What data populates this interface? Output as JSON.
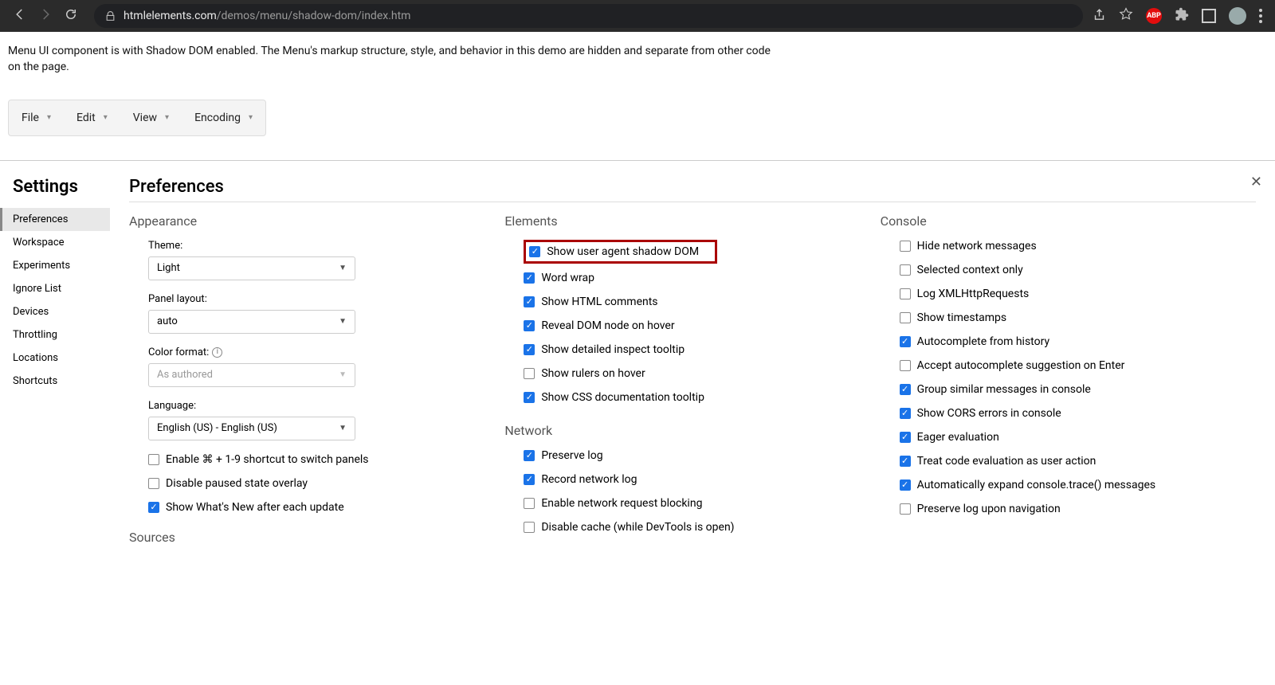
{
  "browser": {
    "url_host": "htmlelements.com",
    "url_rest": "/demos/menu/shadow-dom/index.htm",
    "abp_label": "ABP"
  },
  "page": {
    "description": "Menu UI component is with Shadow DOM enabled. The Menu's markup structure, style, and behavior in this demo are hidden and separate from other code on the page.",
    "menu": [
      "File",
      "Edit",
      "View",
      "Encoding"
    ]
  },
  "devtools": {
    "title": "Settings",
    "panel_title": "Preferences",
    "nav": [
      "Preferences",
      "Workspace",
      "Experiments",
      "Ignore List",
      "Devices",
      "Throttling",
      "Locations",
      "Shortcuts"
    ],
    "appearance": {
      "heading": "Appearance",
      "theme_label": "Theme:",
      "theme_value": "Light",
      "panel_layout_label": "Panel layout:",
      "panel_layout_value": "auto",
      "color_format_label": "Color format:",
      "color_format_value": "As authored",
      "language_label": "Language:",
      "language_value": "English (US) - English (US)",
      "checks": [
        {
          "label": "Enable ⌘ + 1-9 shortcut to switch panels",
          "on": false
        },
        {
          "label": "Disable paused state overlay",
          "on": false
        },
        {
          "label": "Show What's New after each update",
          "on": true
        }
      ],
      "sources_heading": "Sources"
    },
    "elements": {
      "heading": "Elements",
      "checks": [
        {
          "label": "Show user agent shadow DOM",
          "on": true,
          "highlight": true
        },
        {
          "label": "Word wrap",
          "on": true
        },
        {
          "label": "Show HTML comments",
          "on": true
        },
        {
          "label": "Reveal DOM node on hover",
          "on": true
        },
        {
          "label": "Show detailed inspect tooltip",
          "on": true
        },
        {
          "label": "Show rulers on hover",
          "on": false
        },
        {
          "label": "Show CSS documentation tooltip",
          "on": true
        }
      ],
      "network_heading": "Network",
      "network_checks": [
        {
          "label": "Preserve log",
          "on": true
        },
        {
          "label": "Record network log",
          "on": true
        },
        {
          "label": "Enable network request blocking",
          "on": false
        },
        {
          "label": "Disable cache (while DevTools is open)",
          "on": false
        }
      ]
    },
    "console": {
      "heading": "Console",
      "checks": [
        {
          "label": "Hide network messages",
          "on": false
        },
        {
          "label": "Selected context only",
          "on": false
        },
        {
          "label": "Log XMLHttpRequests",
          "on": false
        },
        {
          "label": "Show timestamps",
          "on": false
        },
        {
          "label": "Autocomplete from history",
          "on": true
        },
        {
          "label": "Accept autocomplete suggestion on Enter",
          "on": false
        },
        {
          "label": "Group similar messages in console",
          "on": true
        },
        {
          "label": "Show CORS errors in console",
          "on": true
        },
        {
          "label": "Eager evaluation",
          "on": true
        },
        {
          "label": "Treat code evaluation as user action",
          "on": true
        },
        {
          "label": "Automatically expand console.trace() messages",
          "on": true
        },
        {
          "label": "Preserve log upon navigation",
          "on": false
        }
      ]
    }
  }
}
